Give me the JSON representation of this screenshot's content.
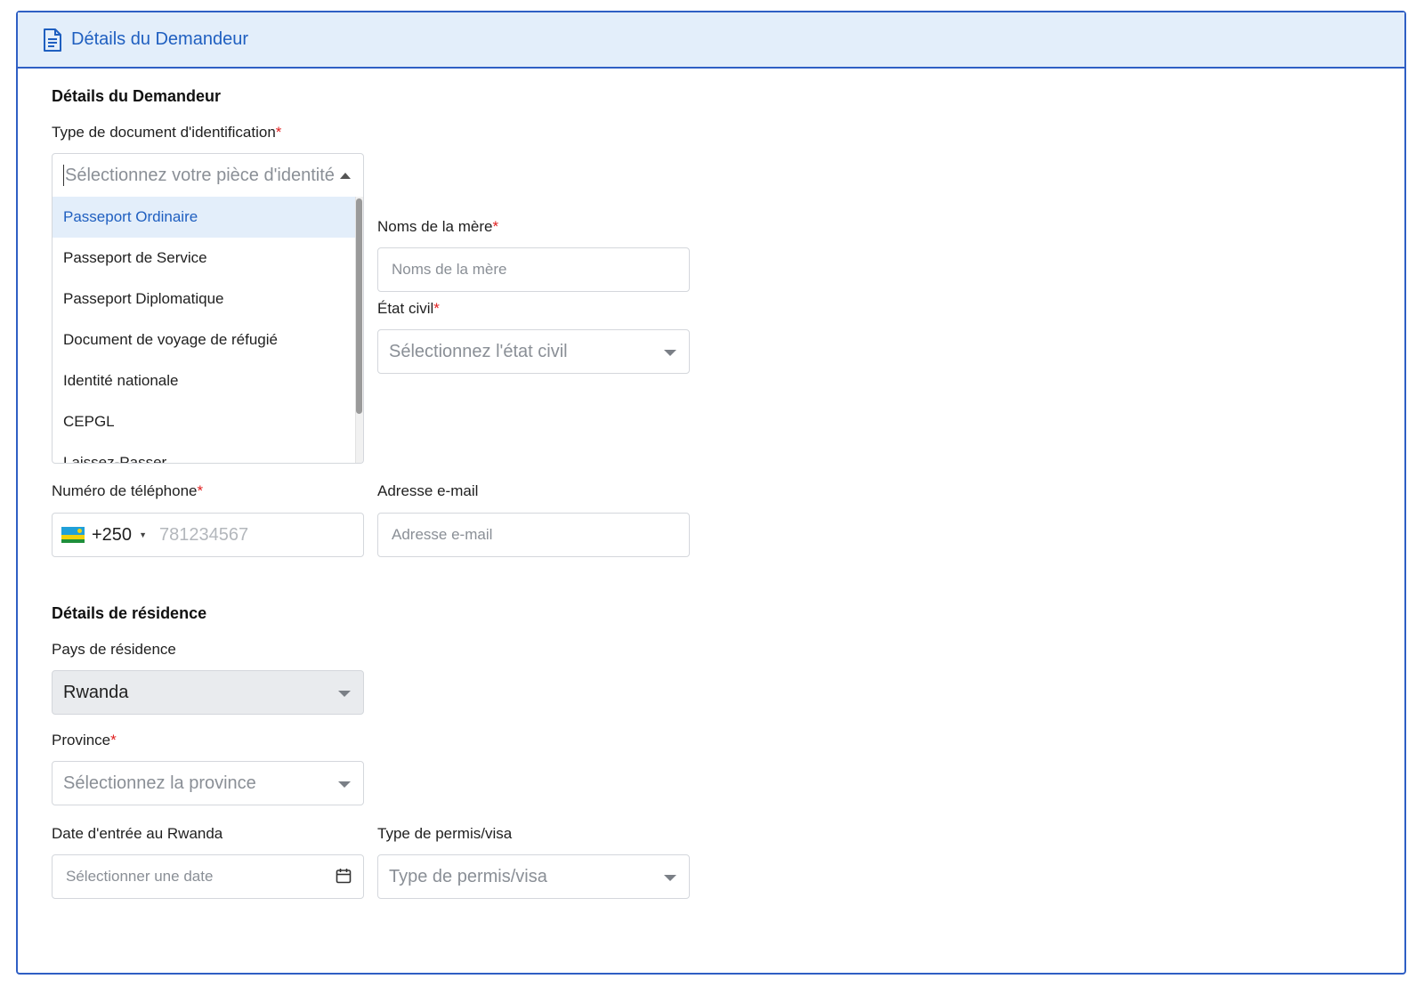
{
  "header": {
    "title": "Détails du Demandeur",
    "icon": "document-icon"
  },
  "applicant": {
    "section_title": "Détails du Demandeur",
    "id_type": {
      "label": "Type de document d'identification",
      "required": "*",
      "placeholder": "Sélectionnez votre pièce d'identité",
      "options": [
        "Passeport Ordinaire",
        "Passeport de Service",
        "Passeport Diplomatique",
        "Document de voyage de réfugié",
        "Identité nationale",
        "CEPGL",
        "Laissez-Passer"
      ],
      "highlighted": "Passeport Ordinaire"
    },
    "mother_name": {
      "label": "Noms de la mère",
      "required": "*",
      "placeholder": "Noms de la mère"
    },
    "civil_status": {
      "label": "État civil",
      "required": "*",
      "placeholder": "Sélectionnez l'état civil"
    },
    "phone": {
      "label": "Numéro de téléphone",
      "required": "*",
      "country_code": "+250",
      "placeholder": "781234567"
    },
    "email": {
      "label": "Adresse e-mail",
      "placeholder": "Adresse e-mail"
    }
  },
  "residence": {
    "section_title": "Détails de résidence",
    "country": {
      "label": "Pays de résidence",
      "value": "Rwanda"
    },
    "province": {
      "label": "Province",
      "required": "*",
      "placeholder": "Sélectionnez la province"
    },
    "entry_date": {
      "label": "Date d'entrée au Rwanda",
      "placeholder": "Sélectionner une date"
    },
    "permit_type": {
      "label": "Type de permis/visa",
      "placeholder": "Type de permis/visa"
    }
  },
  "colors": {
    "accent": "#2f5fc4",
    "header_bg": "#e3eefa",
    "required": "#e02020"
  }
}
